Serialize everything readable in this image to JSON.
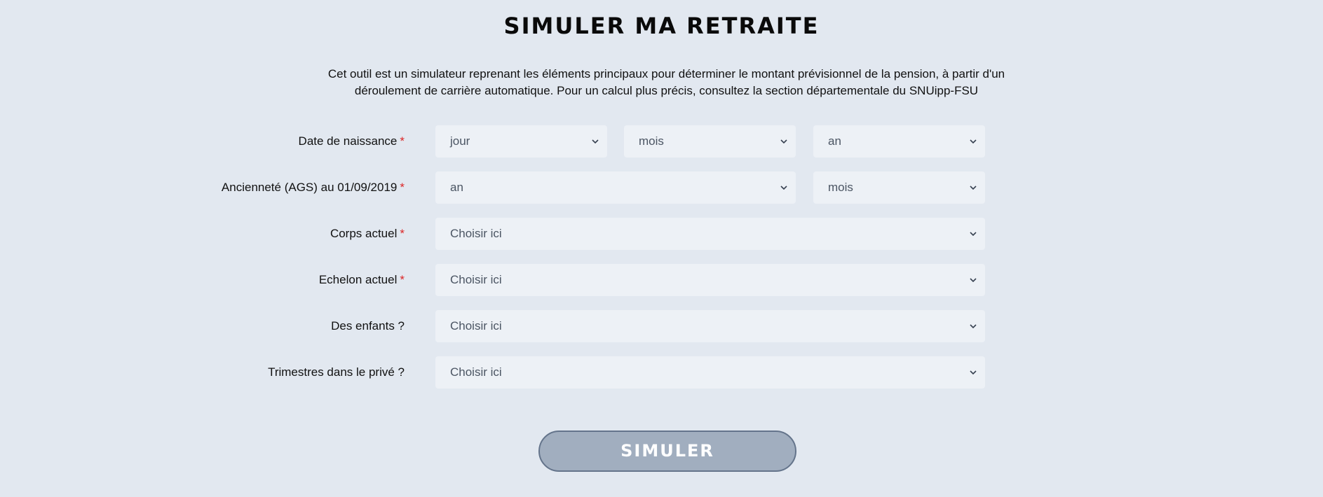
{
  "title": "SIMULER MA RETRAITE",
  "intro": "Cet outil est un simulateur reprenant les éléments principaux pour déterminer le montant prévisionnel de la pension, à partir d'un déroulement de carrière automatique. Pour un calcul plus précis, consultez la section départementale du SNUipp-FSU",
  "required_marker": "*",
  "fields": {
    "birth": {
      "label": "Date de naissance",
      "day": "jour",
      "month": "mois",
      "year": "an"
    },
    "seniority": {
      "label": "Ancienneté (AGS) au 01/09/2019",
      "years": "an",
      "months": "mois"
    },
    "corps": {
      "label": "Corps actuel",
      "value": "Choisir ici"
    },
    "echelon": {
      "label": "Echelon actuel",
      "value": "Choisir ici"
    },
    "children": {
      "label": "Des enfants ?",
      "value": "Choisir ici"
    },
    "private": {
      "label": "Trimestres dans le privé ?",
      "value": "Choisir ici"
    }
  },
  "submit_label": "SIMULER",
  "colors": {
    "background": "#e2e8f0",
    "select_bg": "#edf1f6",
    "required": "#dc2626",
    "button_bg": "#a1aebf",
    "button_border": "#64748b"
  },
  "icons": {
    "dropdown": "chevron-down-icon"
  }
}
